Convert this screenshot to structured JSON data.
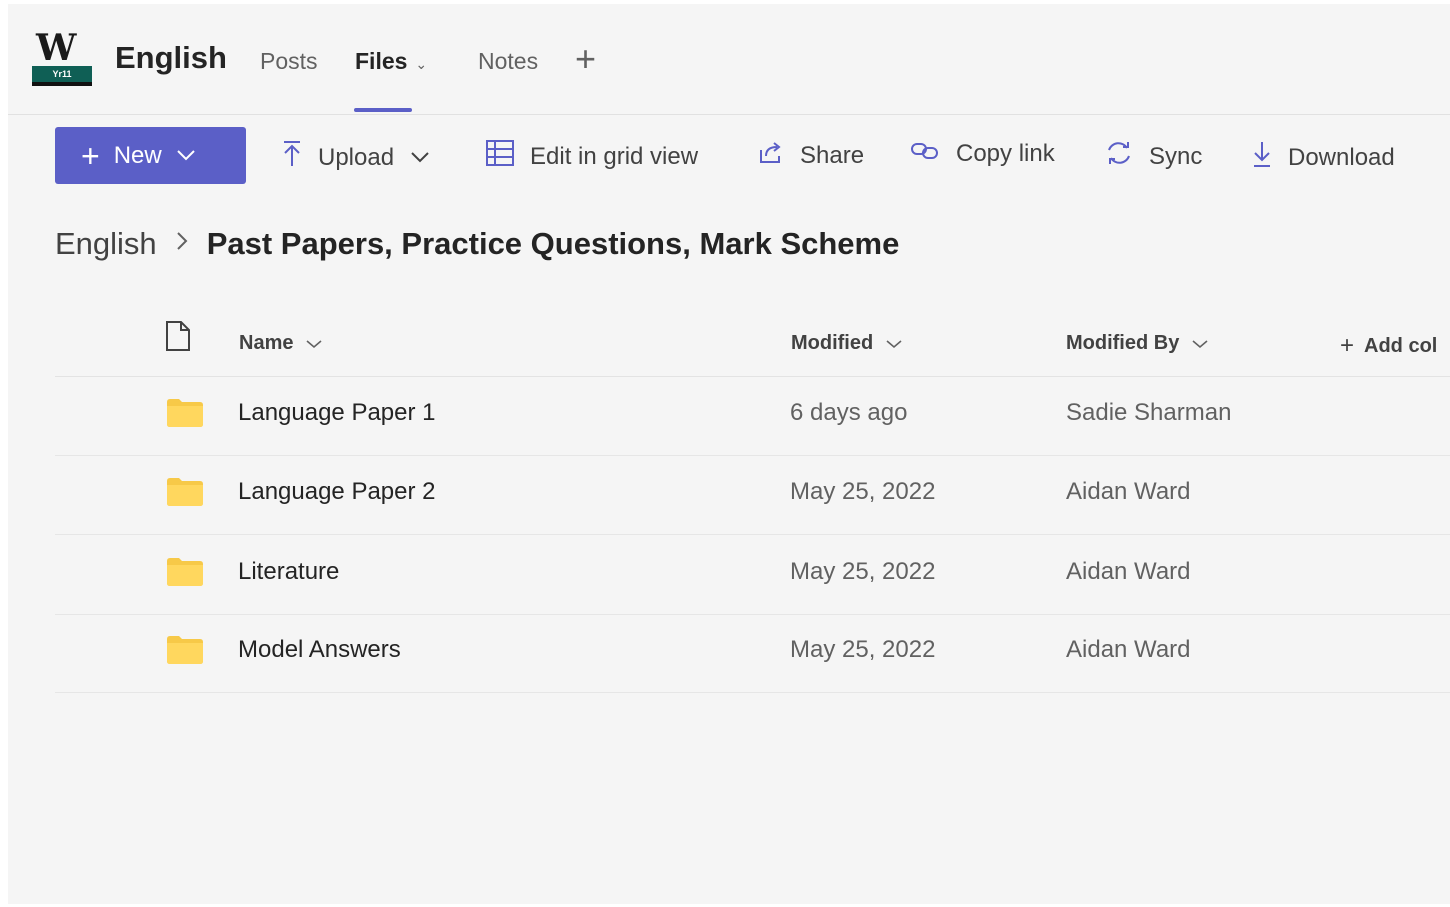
{
  "header": {
    "logo_letter": "W",
    "logo_caption": "Yr11",
    "team_name": "English",
    "tabs": [
      {
        "label": "Posts"
      },
      {
        "label": "Files"
      },
      {
        "label": "Notes"
      }
    ],
    "add_tab_label": "+"
  },
  "toolbar": {
    "new_label": "New",
    "upload_label": "Upload",
    "grid_label": "Edit in grid view",
    "share_label": "Share",
    "copy_label": "Copy link",
    "sync_label": "Sync",
    "download_label": "Download"
  },
  "breadcrumb": {
    "root": "English",
    "current": "Past Papers, Practice Questions, Mark Scheme"
  },
  "table": {
    "columns": {
      "name": "Name",
      "modified": "Modified",
      "modified_by": "Modified By",
      "add_column": "Add col"
    },
    "rows": [
      {
        "name": "Language Paper 1",
        "modified": "6 days ago",
        "modified_by": "Sadie Sharman"
      },
      {
        "name": "Language Paper 2",
        "modified": "May 25, 2022",
        "modified_by": "Aidan Ward"
      },
      {
        "name": "Literature",
        "modified": "May 25, 2022",
        "modified_by": "Aidan Ward"
      },
      {
        "name": "Model Answers",
        "modified": "May 25, 2022",
        "modified_by": "Aidan Ward"
      }
    ]
  },
  "colors": {
    "accent": "#5b5fc7",
    "folder": "#f7c948",
    "logo_green": "#0f5f55"
  },
  "icons": [
    "plus-icon",
    "chevron-down-icon",
    "upload-icon",
    "grid-icon",
    "share-icon",
    "link-icon",
    "sync-icon",
    "download-icon",
    "document-icon",
    "folder-icon",
    "chevron-right-icon"
  ]
}
